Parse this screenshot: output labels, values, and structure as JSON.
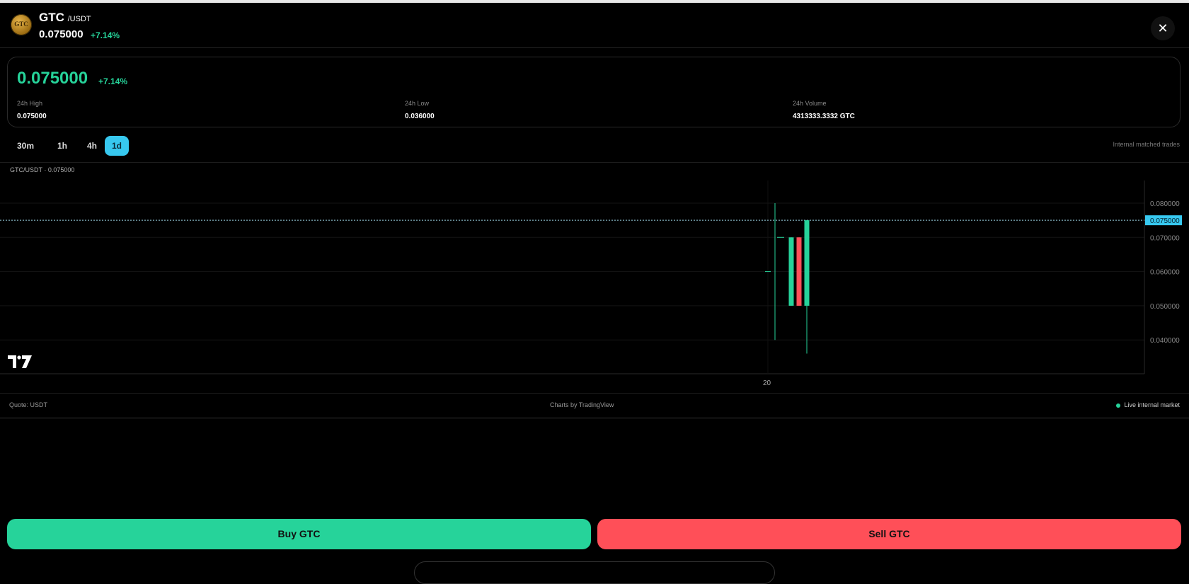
{
  "header": {
    "coin_symbol": "GTC",
    "coin_icon_text": "GTC",
    "pair_suffix": "/USDT",
    "price": "0.075000",
    "change": "+7.14%",
    "close_label": "✕"
  },
  "stats": {
    "price": "0.075000",
    "change": "+7.14%",
    "high_label": "24h High",
    "high_value": "0.075000",
    "low_label": "24h Low",
    "low_value": "0.036000",
    "volume_label": "24h Volume",
    "volume_value": "4313333.3332 GTC"
  },
  "timeframes": [
    "30m",
    "1h",
    "4h",
    "1d"
  ],
  "active_timeframe": "1d",
  "timeframe_note": "Internal matched trades",
  "chart": {
    "title": "GTC/USDT · 0.075000",
    "x_tick": "20",
    "current_price_label": "0.075000"
  },
  "chart_data": {
    "type": "candlestick",
    "y_ticks": [
      0.08,
      0.07,
      0.06,
      0.05,
      0.04
    ],
    "y_tick_labels": [
      "0.080000",
      "0.070000",
      "0.060000",
      "0.050000",
      "0.040000"
    ],
    "ylim": [
      0.03,
      0.085
    ],
    "current_price": 0.075,
    "x_tick_labels": [
      "20"
    ],
    "candles": [
      {
        "open": 0.06,
        "high": 0.06,
        "low": 0.06,
        "close": 0.06,
        "color": "up"
      },
      {
        "open": 0.07,
        "high": 0.08,
        "low": 0.04,
        "close": 0.07,
        "color": "up"
      },
      {
        "open": 0.07,
        "high": 0.07,
        "low": 0.07,
        "close": 0.07,
        "color": "up"
      },
      {
        "open": 0.05,
        "high": 0.07,
        "low": 0.05,
        "close": 0.07,
        "color": "up"
      },
      {
        "open": 0.07,
        "high": 0.07,
        "low": 0.05,
        "close": 0.05,
        "color": "down"
      },
      {
        "open": 0.05,
        "high": 0.075,
        "low": 0.036,
        "close": 0.075,
        "color": "up"
      }
    ],
    "colors": {
      "up": "#26d39a",
      "down": "#ff4f58",
      "price_line": "#37c8ef"
    }
  },
  "footer": {
    "quote": "Quote: USDT",
    "credit": "Charts by TradingView",
    "status": "Live internal market"
  },
  "actions": {
    "buy_label": "Buy GTC",
    "sell_label": "Sell GTC"
  }
}
